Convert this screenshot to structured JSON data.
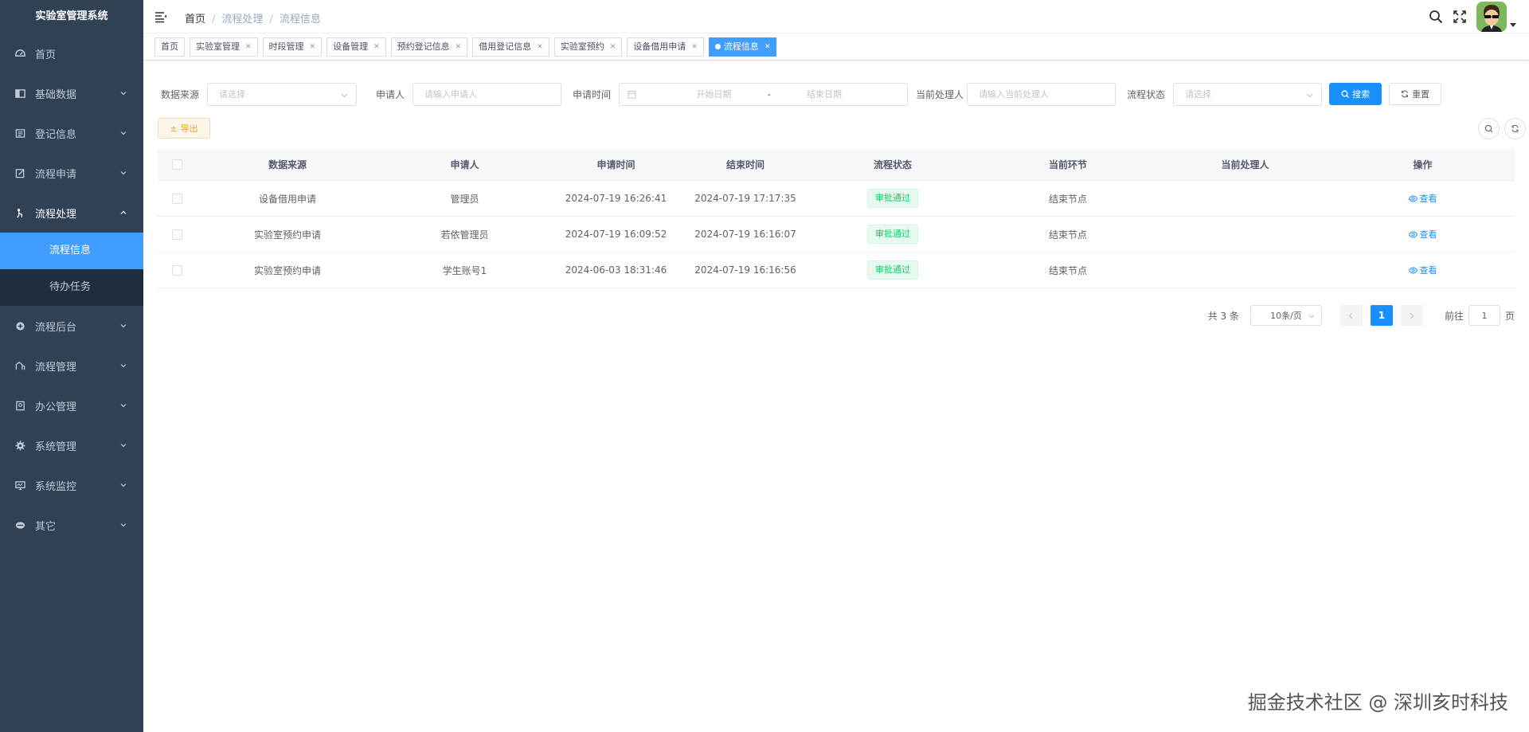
{
  "app": {
    "title": "实验室管理系统"
  },
  "sidebar": {
    "items": [
      {
        "label": "首页",
        "icon": "dashboard-icon"
      },
      {
        "label": "基础数据",
        "icon": "data-icon"
      },
      {
        "label": "登记信息",
        "icon": "register-icon"
      },
      {
        "label": "流程申请",
        "icon": "edit-icon"
      },
      {
        "label": "流程处理",
        "icon": "process-icon"
      },
      {
        "label": "流程后台",
        "icon": "backstage-icon"
      },
      {
        "label": "流程管理",
        "icon": "manage-icon"
      },
      {
        "label": "办公管理",
        "icon": "office-icon"
      },
      {
        "label": "系统管理",
        "icon": "gear-icon"
      },
      {
        "label": "系统监控",
        "icon": "monitor-icon"
      },
      {
        "label": "其它",
        "icon": "other-icon"
      }
    ],
    "submenu": [
      {
        "label": "流程信息"
      },
      {
        "label": "待办任务"
      }
    ]
  },
  "breadcrumb": [
    "首页",
    "流程处理",
    "流程信息"
  ],
  "tags": [
    {
      "label": "首页"
    },
    {
      "label": "实验室管理"
    },
    {
      "label": "时段管理"
    },
    {
      "label": "设备管理"
    },
    {
      "label": "预约登记信息"
    },
    {
      "label": "借用登记信息"
    },
    {
      "label": "实验室预约"
    },
    {
      "label": "设备借用申请"
    },
    {
      "label": "流程信息"
    }
  ],
  "search": {
    "source_label": "数据来源",
    "source_placeholder": "请选择",
    "applicant_label": "申请人",
    "applicant_placeholder": "请输入申请人",
    "time_label": "申请时间",
    "start_placeholder": "开始日期",
    "range_sep": "-",
    "end_placeholder": "结束日期",
    "handler_label": "当前处理人",
    "handler_placeholder": "请输入当前处理人",
    "status_label": "流程状态",
    "status_placeholder": "请选择",
    "search_btn": "搜索",
    "reset_btn": "重置"
  },
  "toolbar": {
    "export_btn": "导出"
  },
  "table": {
    "headers": [
      "数据来源",
      "申请人",
      "申请时间",
      "结束时间",
      "流程状态",
      "当前环节",
      "当前处理人",
      "操作"
    ],
    "rows": [
      {
        "source": "设备借用申请",
        "applicant": "管理员",
        "start": "2024-07-19 16:26:41",
        "end": "2024-07-19 17:17:35",
        "status": "审批通过",
        "node": "结束节点",
        "handler": "",
        "op": "查看"
      },
      {
        "source": "实验室预约申请",
        "applicant": "若依管理员",
        "start": "2024-07-19 16:09:52",
        "end": "2024-07-19 16:16:07",
        "status": "审批通过",
        "node": "结束节点",
        "handler": "",
        "op": "查看"
      },
      {
        "source": "实验室预约申请",
        "applicant": "学生账号1",
        "start": "2024-06-03 18:31:46",
        "end": "2024-07-19 16:16:56",
        "status": "审批通过",
        "node": "结束节点",
        "handler": "",
        "op": "查看"
      }
    ]
  },
  "pagination": {
    "total": "共 3 条",
    "size": "10条/页",
    "current": "1",
    "jump_label": "前往",
    "jump_value": "1",
    "jump_suffix": "页"
  },
  "watermark": "掘金技术社区 @ 深圳亥时科技",
  "colors": {
    "sidebar": "#304156",
    "primary": "#1890ff",
    "active_menu": "#409eff",
    "success": "#13ce66",
    "warning": "#e6a23c"
  }
}
